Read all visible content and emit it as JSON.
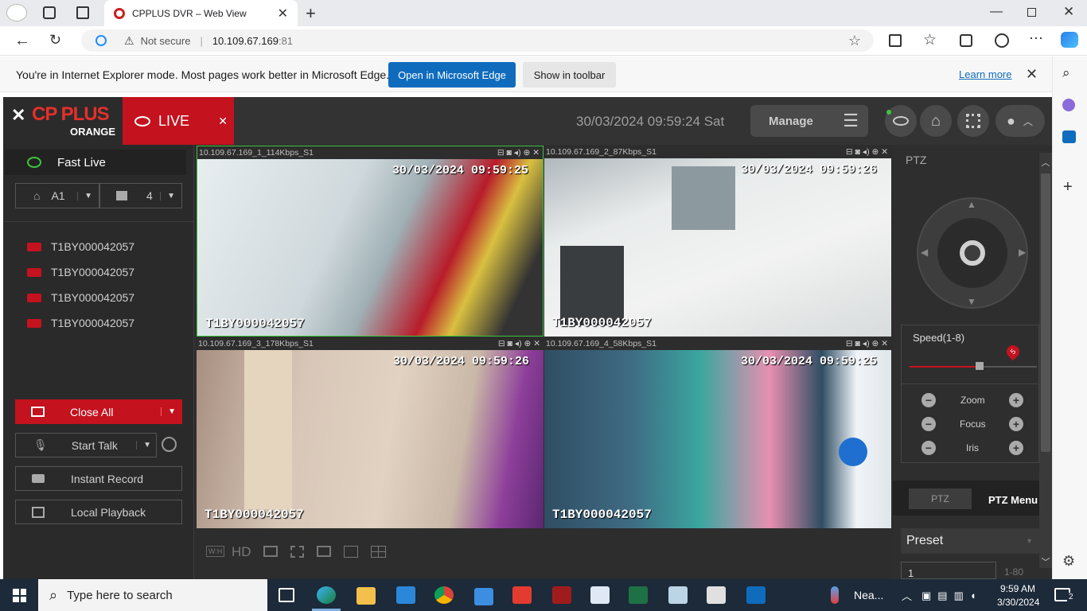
{
  "browser": {
    "tab_title": "CPPLUS DVR – Web View",
    "url_security": "Not secure",
    "url_host": "10.109.67.169",
    "url_port": ":81"
  },
  "ie_bar": {
    "message": "You're in Internet Explorer mode. Most pages work better in Microsoft Edge.",
    "open_edge": "Open in Microsoft Edge",
    "show_toolbar": "Show in toolbar",
    "learn_more": "Learn more"
  },
  "app": {
    "logo_text": "CP PLUS",
    "logo_sub": "ORANGE",
    "live_label": "LIVE",
    "datetime": "30/03/2024 09:59:24 Sat",
    "manage_label": "Manage"
  },
  "left": {
    "fast_live": "Fast Live",
    "group_select": "A1",
    "layout_select": "4",
    "devices": [
      "T1BY000042057",
      "T1BY000042057",
      "T1BY000042057",
      "T1BY000042057"
    ],
    "close_all": "Close All",
    "start_talk": "Start Talk",
    "instant_record": "Instant Record",
    "local_playback": "Local Playback"
  },
  "videos": [
    {
      "header": "10.109.67.169_1_114Kbps_S1",
      "timestamp": "30/03/2024 09:59:25",
      "name": "T1BY000042057"
    },
    {
      "header": "10.109.67.169_2_87Kbps_S1",
      "timestamp": "30/03/2024 09:59:26",
      "name": "T1BY000042057"
    },
    {
      "header": "10.109.67.169_3_178Kbps_S1",
      "timestamp": "30/03/2024 09:59:26",
      "name": "T1BY000042057"
    },
    {
      "header": "10.109.67.169_4_58Kbps_S1",
      "timestamp": "30/03/2024 09:59:25",
      "name": "T1BY000042057"
    }
  ],
  "bottom_toolbar": {
    "wh": "W:H",
    "hd": "HD"
  },
  "ptz": {
    "title": "PTZ",
    "speed_label": "Speed(1-8)",
    "speed_value": "5",
    "zoom": "Zoom",
    "focus": "Focus",
    "iris": "Iris",
    "tab_ptz": "PTZ",
    "tab_menu": "PTZ Menu",
    "preset_label": "Preset",
    "preset_value": "1",
    "preset_range": "1-80"
  },
  "taskbar": {
    "search_placeholder": "Type here to search",
    "weather": "Nea...",
    "time": "9:59 AM",
    "date": "3/30/2024",
    "notif_count": "2"
  },
  "colors": {
    "accent_red": "#c4121f",
    "edge_blue": "#0f6cbd",
    "selected_green": "#3ec43e"
  }
}
